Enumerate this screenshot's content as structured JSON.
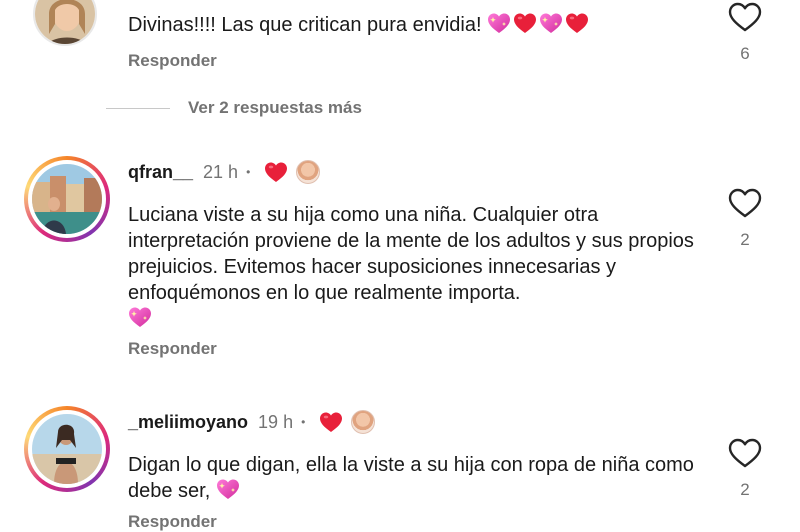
{
  "comments": [
    {
      "username": "",
      "time": "",
      "text": "Divinas!!!! Las que critican pura envidia!",
      "emojis": [
        "sparkling-heart",
        "red-heart",
        "sparkling-heart",
        "red-heart"
      ],
      "reply_label": "Responder",
      "likes": "6"
    },
    {
      "username": "qfran__",
      "time": "21 h",
      "dot": "•",
      "text": "Luciana viste a su hija como una niña. Cualquier otra interpretación proviene de la mente de los adultos y sus propios prejuicios. Evitemos hacer suposiciones innecesarias y enfoquémonos en lo que realmente importa.",
      "emojis": [
        "sparkling-heart"
      ],
      "reply_label": "Responder",
      "likes": "2"
    },
    {
      "username": "_meliimoyano",
      "time": "19 h",
      "dot": "•",
      "text": "Digan lo que digan, ella la viste a su hija con ropa de niña como debe ser,",
      "emojis": [
        "sparkling-heart"
      ],
      "reply_label": "Responder",
      "likes": "2"
    }
  ],
  "view_more_replies": "Ver 2 respuestas más",
  "colors": {
    "text": "#1a1a1a",
    "muted": "#737373",
    "heart_red": "#e8203a",
    "sparkle_pink": "#e83fbf"
  },
  "icons": {
    "like": "heart-outline-icon",
    "author_liked": "red-heart-icon",
    "sparkling_heart": "sparkling-heart-emoji",
    "red_heart": "red-heart-emoji"
  }
}
